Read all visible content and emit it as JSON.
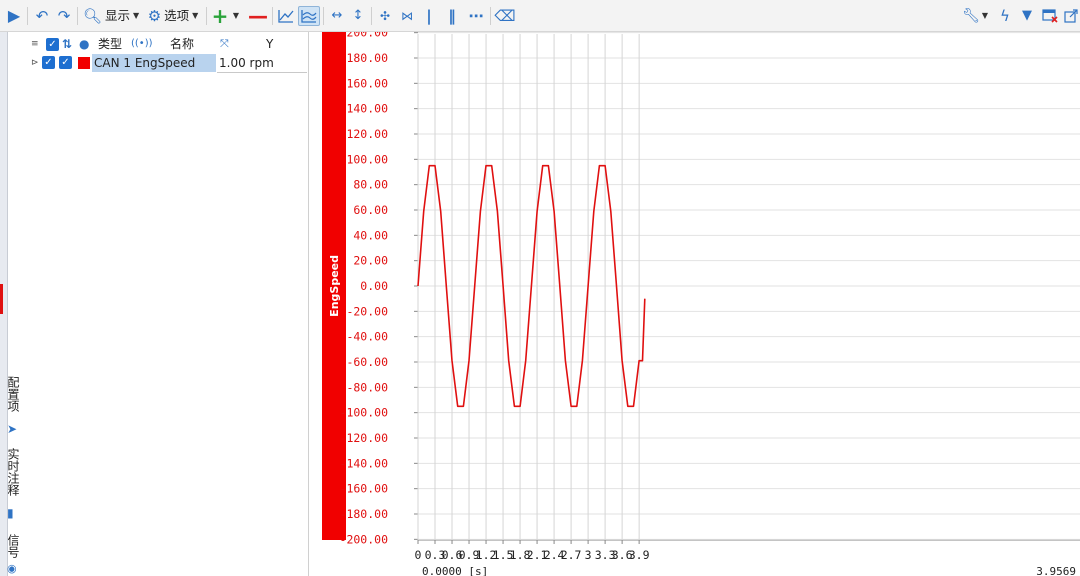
{
  "toolbar": {
    "display_label": "显示",
    "options_label": "选项"
  },
  "left_tabs": {
    "config": "配置项",
    "annotation": "实时注释",
    "signal": "信号"
  },
  "signal_table": {
    "headers": {
      "type": "类型",
      "name": "名称",
      "y": "Y"
    },
    "rows": [
      {
        "name": "CAN 1 EngSpeed",
        "value": "1.00 rpm",
        "color": "#f10000"
      }
    ]
  },
  "chart_data": {
    "type": "line",
    "ylabel": "EngSpeed",
    "xlabel": "",
    "xlim": [
      0,
      4.0
    ],
    "ylim": [
      -210,
      210
    ],
    "yticks": [
      "200.00",
      "180.00",
      "160.00",
      "140.00",
      "120.00",
      "100.00",
      "80.00",
      "60.00",
      "40.00",
      "20.00",
      "0.00",
      "-20.00",
      "-40.00",
      "-60.00",
      "-80.00",
      "-100.00",
      "-120.00",
      "-140.00",
      "-160.00",
      "-180.00",
      "-200.00"
    ],
    "xticks": [
      "0",
      "0.3",
      "0.6",
      "0.9",
      "1.2",
      "1.5",
      "1.8",
      "2.1",
      "2.4",
      "2.7",
      "3",
      "3.3",
      "3.6",
      "3.9"
    ],
    "x_start_label": "0.0000 [s]",
    "x_end_label": "3.9569",
    "color": "#e01010",
    "series": [
      {
        "x": [
          0,
          0.1,
          0.2,
          0.3,
          0.4,
          0.5,
          0.6,
          0.7,
          0.8,
          0.9,
          1.0,
          1.1,
          1.2,
          1.3,
          1.4,
          1.5,
          1.6,
          1.7,
          1.8,
          1.9,
          2.0,
          2.1,
          2.2,
          2.3,
          2.4,
          2.5,
          2.6,
          2.7,
          2.8,
          2.9,
          3.0,
          3.1,
          3.2,
          3.3,
          3.4,
          3.5,
          3.6,
          3.7,
          3.8,
          3.9,
          3.96,
          4.0
        ],
        "y": [
          0,
          59,
          95,
          95,
          59,
          0,
          -59,
          -95,
          -95,
          -59,
          0,
          59,
          95,
          95,
          59,
          0,
          -59,
          -95,
          -95,
          -59,
          0,
          59,
          95,
          95,
          59,
          0,
          -59,
          -95,
          -95,
          -59,
          0,
          59,
          95,
          95,
          59,
          0,
          -59,
          -95,
          -95,
          -59,
          -59,
          -10
        ]
      }
    ]
  }
}
